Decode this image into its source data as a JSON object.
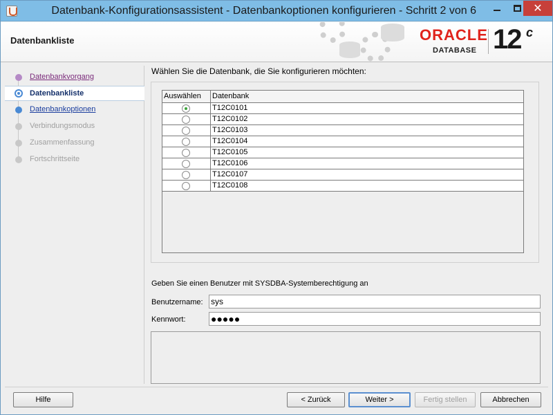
{
  "window": {
    "title": "Datenbank-Konfigurationsassistent - Datenbankoptionen konfigurieren - Schritt 2 von 6",
    "close_glyph": "✕"
  },
  "header": {
    "title": "Datenbankliste",
    "logo": {
      "brand": "ORACLE",
      "product": "DATABASE",
      "version": "12",
      "version_suffix": "c"
    }
  },
  "sidebar": {
    "steps": [
      {
        "label": "Datenbankvorgang",
        "state": "visited"
      },
      {
        "label": "Datenbankliste",
        "state": "current"
      },
      {
        "label": "Datenbankoptionen",
        "state": "link"
      },
      {
        "label": "Verbindungsmodus",
        "state": "disabled"
      },
      {
        "label": "Zusammenfassung",
        "state": "disabled"
      },
      {
        "label": "Fortschrittseite",
        "state": "disabled"
      }
    ]
  },
  "main": {
    "prompt": "Wählen Sie die Datenbank, die Sie konfigurieren möchten:",
    "table": {
      "headers": {
        "select": "Auswählen",
        "database": "Datenbank"
      },
      "rows": [
        {
          "name": "T12C0101",
          "selected": true
        },
        {
          "name": "T12C0102",
          "selected": false
        },
        {
          "name": "T12C0103",
          "selected": false
        },
        {
          "name": "T12C0104",
          "selected": false
        },
        {
          "name": "T12C0105",
          "selected": false
        },
        {
          "name": "T12C0106",
          "selected": false
        },
        {
          "name": "T12C0107",
          "selected": false
        },
        {
          "name": "T12C0108",
          "selected": false
        }
      ]
    },
    "sysdba_text": "Geben Sie einen Benutzer mit SYSDBA-Systemberechtigung an",
    "username": {
      "label": "Benutzername:",
      "value": "sys"
    },
    "password": {
      "label": "Kennwort:",
      "masked_value": "●●●●●"
    }
  },
  "footer": {
    "help": "Hilfe",
    "back": "< Zurück",
    "next": "Weiter >",
    "finish": "Fertig stellen",
    "cancel": "Abbrechen"
  },
  "colors": {
    "titlebar": "#7fbde6",
    "close_button": "#c7403a",
    "oracle_red": "#e0231c",
    "selected_radio": "#3ba33b"
  }
}
